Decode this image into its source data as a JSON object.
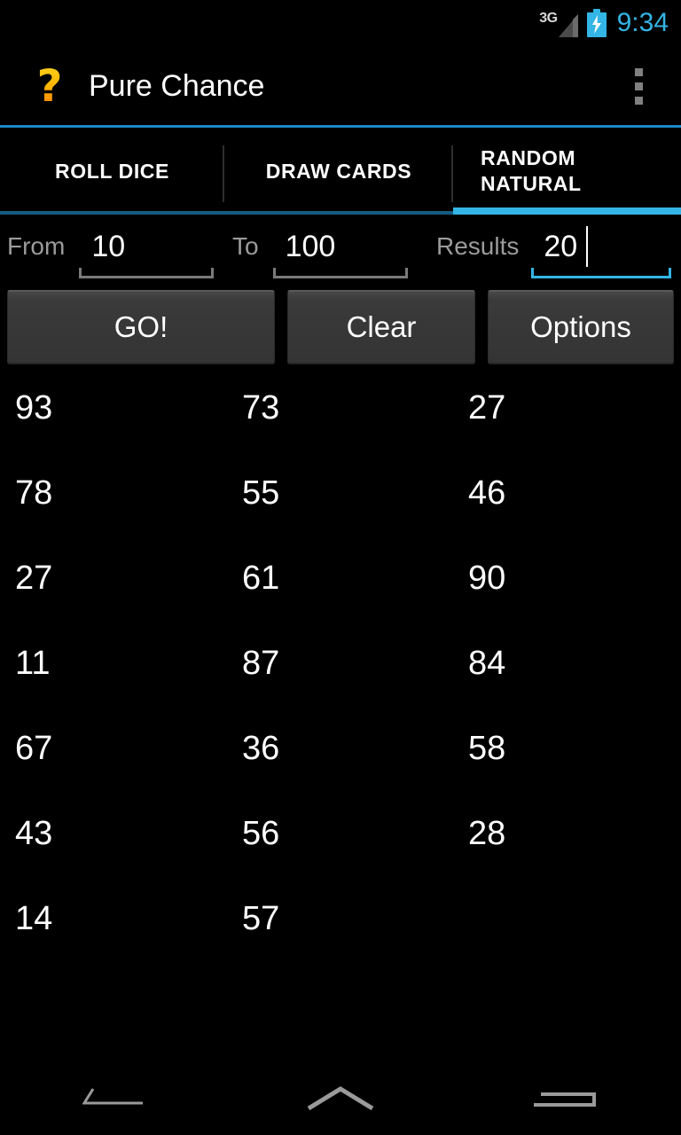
{
  "status_bar": {
    "network_label": "3G",
    "signal_icon": "signal-triangle-icon",
    "battery_icon": "battery-charging-icon",
    "time": "9:34",
    "accent_color": "#33b5e5"
  },
  "action_bar": {
    "app_icon": "question-mark-icon",
    "app_icon_glyph": "?",
    "title": "Pure Chance",
    "overflow_icon": "overflow-menu-icon"
  },
  "tabs": [
    {
      "label": "ROLL DICE",
      "active": false
    },
    {
      "label": "DRAW CARDS",
      "active": false
    },
    {
      "label": "RANDOM NATURAL",
      "active": true
    }
  ],
  "inputs": {
    "from": {
      "label": "From",
      "value": "10",
      "focused": false
    },
    "to": {
      "label": "To",
      "value": "100",
      "focused": false
    },
    "results": {
      "label": "Results",
      "value": "20",
      "focused": true
    }
  },
  "buttons": {
    "go": "GO!",
    "clear": "Clear",
    "options": "Options"
  },
  "results_grid": {
    "columns": 3,
    "count": 20,
    "rows": [
      [
        "93",
        "73",
        "27"
      ],
      [
        "78",
        "55",
        "46"
      ],
      [
        "27",
        "61",
        "90"
      ],
      [
        "11",
        "87",
        "84"
      ],
      [
        "67",
        "36",
        "58"
      ],
      [
        "43",
        "56",
        "28"
      ],
      [
        "14",
        "57",
        ""
      ]
    ]
  },
  "nav_bar": {
    "back": "back-icon",
    "home": "home-icon",
    "recents": "recents-icon"
  }
}
